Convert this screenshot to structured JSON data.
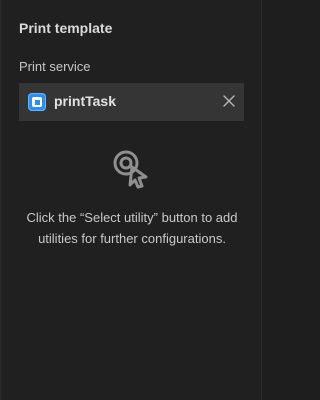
{
  "panel": {
    "title": "Print template",
    "section_label": "Print service",
    "service": {
      "name": "printTask",
      "icon": "print-service-icon",
      "remove_icon": "close-icon"
    },
    "empty_state": {
      "icon": "select-pointer-icon",
      "message": "Click the “Select utility” button to add utilities for further configurations."
    }
  }
}
